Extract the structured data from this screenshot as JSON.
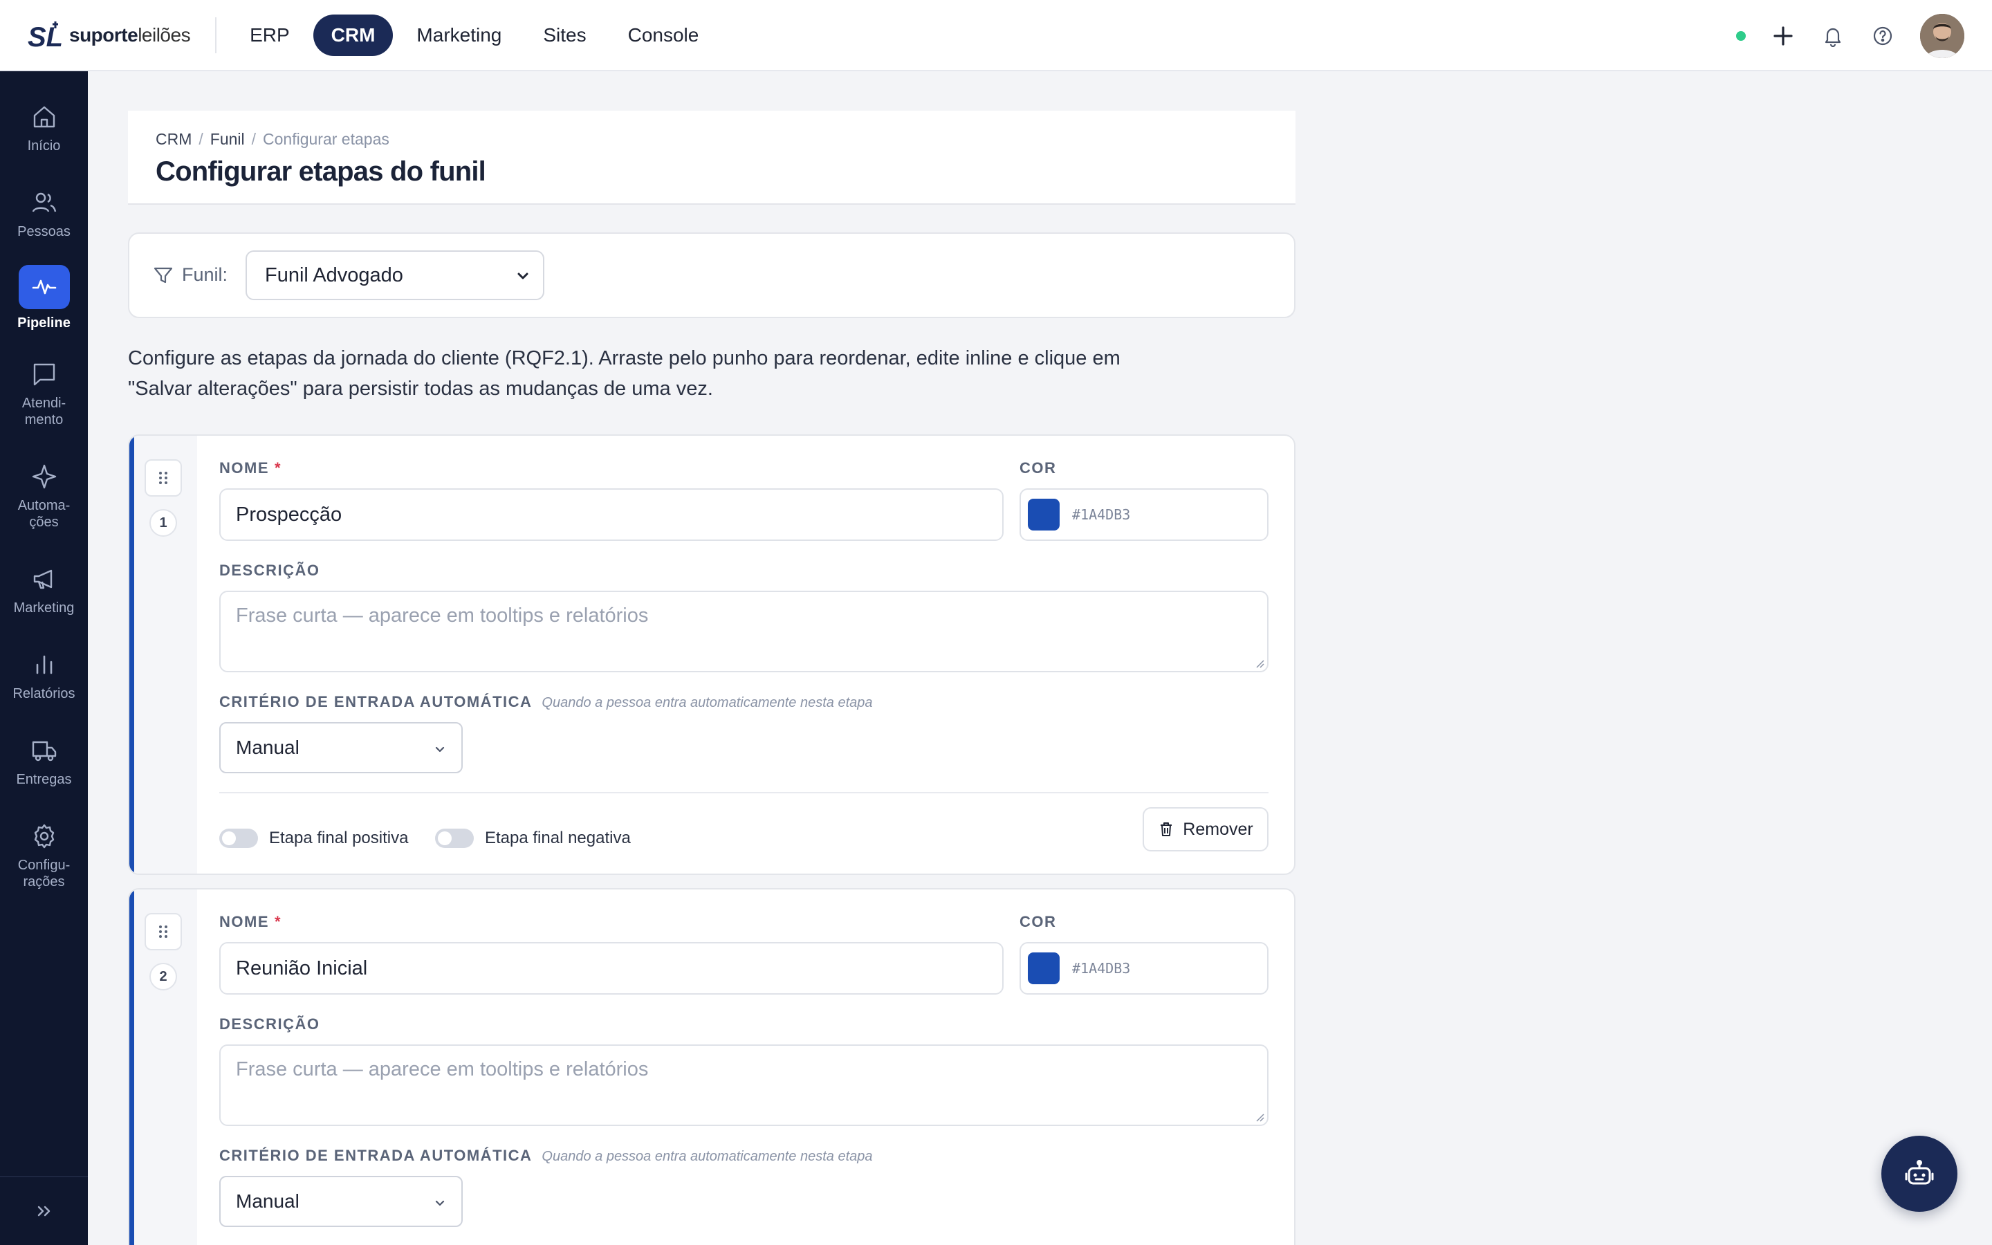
{
  "brand": {
    "name_bold": "suporte",
    "name_light": "leilões"
  },
  "topnav": {
    "items": [
      "ERP",
      "CRM",
      "Marketing",
      "Sites",
      "Console"
    ],
    "active": "CRM"
  },
  "topbar_icons": [
    "status-dot",
    "plus-icon",
    "bell-icon",
    "help-icon",
    "avatar"
  ],
  "sidebar": {
    "items": [
      {
        "label": "Início",
        "icon": "home-icon"
      },
      {
        "label": "Pessoas",
        "icon": "people-icon"
      },
      {
        "label": "Pipeline",
        "icon": "pulse-icon",
        "active": true
      },
      {
        "label": "Atendi-\nmento",
        "icon": "chat-icon"
      },
      {
        "label": "Automa-\nções",
        "icon": "sparkle-icon"
      },
      {
        "label": "Marketing",
        "icon": "megaphone-icon"
      },
      {
        "label": "Relatórios",
        "icon": "bar-chart-icon"
      },
      {
        "label": "Entregas",
        "icon": "truck-icon"
      },
      {
        "label": "Configu-\nrações",
        "icon": "gear-icon"
      }
    ],
    "collapse_icon": "double-chevron-right-icon"
  },
  "header": {
    "breadcrumb": [
      "CRM",
      "Funil",
      "Configurar etapas"
    ],
    "title": "Configurar etapas do funil"
  },
  "filter": {
    "label": "Funil:",
    "selected": "Funil Advogado"
  },
  "intro": "Configure as etapas da jornada do cliente (RQF2.1). Arraste pelo punho para reordenar, edite inline e clique em \"Salvar alterações\" para persistir todas as mudanças de uma vez.",
  "labels": {
    "name": "NOME",
    "required": "*",
    "color": "COR",
    "description": "DESCRIÇÃO",
    "criteria": "CRITÉRIO DE ENTRADA AUTOMÁTICA",
    "criteria_hint": "Quando a pessoa entra automaticamente nesta etapa",
    "description_placeholder": "Frase curta — aparece em tooltips e relatórios",
    "final_positive": "Etapa final positiva",
    "final_negative": "Etapa final negativa",
    "remove": "Remover"
  },
  "stages": [
    {
      "order": "1",
      "name": "Prospecção",
      "color": "#1A4DB3",
      "criteria": "Manual",
      "final_positive": false,
      "final_negative": false
    },
    {
      "order": "2",
      "name": "Reunião Inicial",
      "color": "#1A4DB3",
      "criteria": "Manual",
      "final_positive": false,
      "final_negative": false
    }
  ],
  "colors": {
    "accent": "#1a4db3",
    "nav_active": "#1b2a56",
    "sidebar_bg": "#0f172e",
    "sidebar_active": "#2f5de6",
    "status": "#2ecc8a",
    "required": "#d9354b"
  },
  "assistant_button": "robot-icon"
}
